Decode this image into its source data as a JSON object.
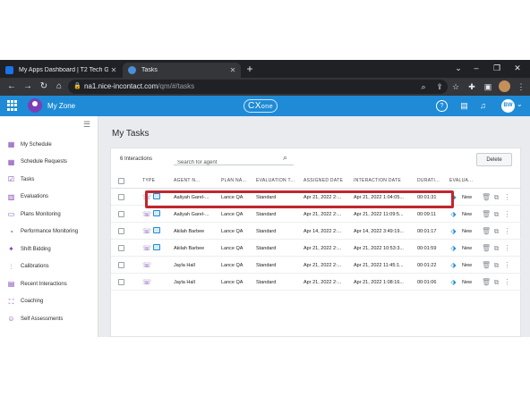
{
  "browser": {
    "tabs": [
      {
        "title": "My Apps Dashboard | T2 Tech Gr",
        "favicon_color": "#1a73e8"
      },
      {
        "title": "Tasks",
        "favicon_color": "#4a90d9"
      }
    ],
    "url_host": "na1.nice-incontact.com",
    "url_path": "/qm/#/tasks"
  },
  "header": {
    "zone_title": "My Zone",
    "brand": "CX",
    "brand_suffix": "one",
    "user_initials": "BW"
  },
  "sidebar": {
    "items": [
      {
        "label": "My Schedule",
        "icon": "calendar-icon"
      },
      {
        "label": "Schedule Requests",
        "icon": "calendar-request-icon"
      },
      {
        "label": "Tasks",
        "icon": "tasks-icon"
      },
      {
        "label": "Evaluations",
        "icon": "evaluations-icon"
      },
      {
        "label": "Plans Monitoring",
        "icon": "plans-monitoring-icon"
      },
      {
        "label": "Performance Monitoring",
        "icon": "performance-icon"
      },
      {
        "label": "Shift Bidding",
        "icon": "shift-bidding-icon"
      },
      {
        "label": "Calibrations",
        "icon": "calibrations-icon"
      },
      {
        "label": "Recent Interactions",
        "icon": "recent-interactions-icon"
      },
      {
        "label": "Coaching",
        "icon": "coaching-icon"
      },
      {
        "label": "Self Assessments",
        "icon": "self-assessments-icon"
      }
    ]
  },
  "main": {
    "title": "My Tasks",
    "interaction_count": "6 Interactions",
    "search_placeholder": "Search for agent",
    "delete_label": "Delete",
    "columns": {
      "type": "TYPE",
      "agent": "AGENT N...",
      "plan": "PLAN NA...",
      "evaluation": "EVALUATION T...",
      "assigned": "ASSIGNED DATE",
      "interaction": "INTERACTION DATE",
      "duration": "DURATI...",
      "evaluation_status": "EVALUA..."
    },
    "rows": [
      {
        "agent": "Aaliyah Garel-...",
        "plan": "Lance QA",
        "evaluation": "Standard",
        "assigned": "Apr 21, 2022 2:...",
        "interaction": "Apr 21, 2022 1:04:05...",
        "duration": "00:01:31",
        "status": "New",
        "has_screen": true
      },
      {
        "agent": "Aaliyah Garel-...",
        "plan": "Lance QA",
        "evaluation": "Standard",
        "assigned": "Apr 21, 2022 2:...",
        "interaction": "Apr 21, 2022 11:09:5...",
        "duration": "00:09:11",
        "status": "New",
        "has_screen": true
      },
      {
        "agent": "Akilah Barbee",
        "plan": "Lance QA",
        "evaluation": "Standard",
        "assigned": "Apr 14, 2022 2:...",
        "interaction": "Apr 14, 2022 3:49:19...",
        "duration": "00:01:17",
        "status": "New",
        "has_screen": true
      },
      {
        "agent": "Akilah Barbee",
        "plan": "Lance QA",
        "evaluation": "Standard",
        "assigned": "Apr 21, 2022 2:...",
        "interaction": "Apr 21, 2022 10:53:3...",
        "duration": "00:01:59",
        "status": "New",
        "has_screen": true
      },
      {
        "agent": "Jayla Hall",
        "plan": "Lance QA",
        "evaluation": "Standard",
        "assigned": "Apr 21, 2022 2:...",
        "interaction": "Apr 21, 2022 11:45:1...",
        "duration": "00:01:22",
        "status": "New",
        "has_screen": false
      },
      {
        "agent": "Jayla Hall",
        "plan": "Lance QA",
        "evaluation": "Standard",
        "assigned": "Apr 21, 2022 2:...",
        "interaction": "Apr 21, 2022 1:08:16...",
        "duration": "00:01:06",
        "status": "New",
        "has_screen": false
      }
    ],
    "highlighted_row": 1
  },
  "colors": {
    "header_blue": "#1f8bd6",
    "accent_purple": "#7b3fb5",
    "highlight_red": "#c0272d"
  }
}
